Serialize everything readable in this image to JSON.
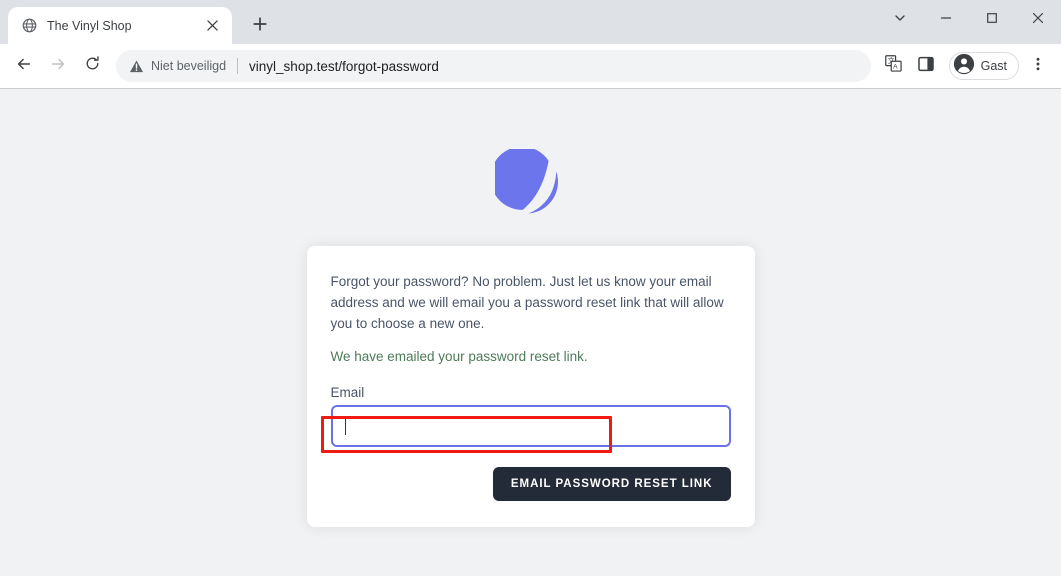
{
  "browser": {
    "tab": {
      "title": "The Vinyl Shop",
      "favicon_icon": "globe-icon",
      "close_icon": "close-icon"
    },
    "new_tab_icon": "plus-icon",
    "window_controls": {
      "tab_search_icon": "chevron-down-icon",
      "minimize_icon": "minimize-icon",
      "maximize_icon": "maximize-icon",
      "close_icon": "close-icon"
    },
    "toolbar": {
      "back_icon": "arrow-left-icon",
      "forward_icon": "arrow-right-icon",
      "reload_icon": "reload-icon",
      "security_icon": "warning-triangle-icon",
      "security_label": "Niet beveiligd",
      "url": "vinyl_shop.test/forgot-password",
      "translate_icon": "translate-icon",
      "side_panel_icon": "side-panel-icon",
      "profile_icon": "account-circle-icon",
      "profile_name": "Gast",
      "menu_icon": "three-dots-vertical-icon"
    }
  },
  "page": {
    "logo_icon": "application-mark-logo",
    "logo_color": "#6c75eb",
    "background_color": "#f1f2f4",
    "card": {
      "intro_text": "Forgot your password? No problem. Just let us know your email address and we will email you a password reset link that will allow you to choose a new one.",
      "success_message": "We have emailed your password reset link.",
      "success_color": "#4e7a58",
      "email_label": "Email",
      "email_value": "",
      "email_placeholder": "",
      "submit_label": "Email Password Reset Link",
      "submit_bg": "#242b38",
      "input_focus_color": "#6b72e8"
    }
  },
  "annotation": {
    "color": "#f01c14",
    "target": "success-message"
  }
}
